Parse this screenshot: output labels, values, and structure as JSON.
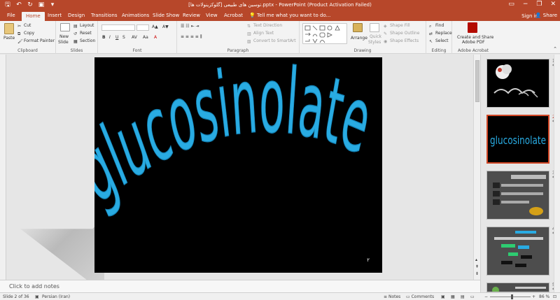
{
  "window": {
    "title": "توسین های طبیعی [گلوکزینولات ها].pptx - PowerPoint (Product Activation Failed)",
    "minimize_icon": "minimize-icon",
    "restore_icon": "restore-icon",
    "close_icon": "close-icon"
  },
  "tabs": {
    "file": "File",
    "home": "Home",
    "insert": "Insert",
    "design": "Design",
    "transitions": "Transitions",
    "animations": "Animations",
    "slideshow": "Slide Show",
    "review": "Review",
    "view": "View",
    "acrobat": "Acrobat",
    "tellme": "Tell me what you want to do...",
    "signin": "Sign in",
    "share": "Share"
  },
  "ribbon": {
    "clipboard": {
      "paste": "Paste",
      "cut": "Cut",
      "copy": "Copy",
      "format_painter": "Format Painter",
      "label": "Clipboard"
    },
    "slides": {
      "new_slide": "New",
      "new_slide2": "Slide",
      "layout": "Layout",
      "reset": "Reset",
      "section": "Section",
      "label": "Slides"
    },
    "font": {
      "bold": "B",
      "italic": "I",
      "underline": "U",
      "strike": "S",
      "label": "Font"
    },
    "paragraph": {
      "text_direction": "Text Direction",
      "align_text": "Align Text",
      "convert_smartart": "Convert to SmartArt",
      "label": "Paragraph"
    },
    "drawing": {
      "arrange": "Arrange",
      "quick_styles": "Quick",
      "quick_styles2": "Styles",
      "shape_fill": "Shape Fill",
      "shape_outline": "Shape Outline",
      "shape_effects": "Shape Effects",
      "label": "Drawing"
    },
    "editing": {
      "find": "Find",
      "replace": "Replace",
      "select": "Select",
      "label": "Editing"
    },
    "acrobat": {
      "create_share": "Create and Share",
      "create_share2": "Adobe PDF",
      "label": "Adobe Acrobat"
    }
  },
  "slide": {
    "title_word": "glucosinolate",
    "page_number": "۲",
    "text_color": "#29abe2",
    "background": "#000000"
  },
  "thumbnails": [
    {
      "number": "1",
      "star": "*"
    },
    {
      "number": "2",
      "star": "*",
      "word": "glucosinolate"
    },
    {
      "number": "3",
      "star": "*"
    },
    {
      "number": "4",
      "star": "*"
    },
    {
      "number": "5",
      "star": "*"
    }
  ],
  "notes": {
    "placeholder": "Click to add notes"
  },
  "status": {
    "slide_info": "Slide 2 of 36",
    "language": "Persian (Iran)",
    "notes": "Notes",
    "comments": "Comments",
    "zoom": "86 %"
  },
  "colors": {
    "accent": "#b7472a",
    "ribbon_bg": "#f3f3f3"
  }
}
